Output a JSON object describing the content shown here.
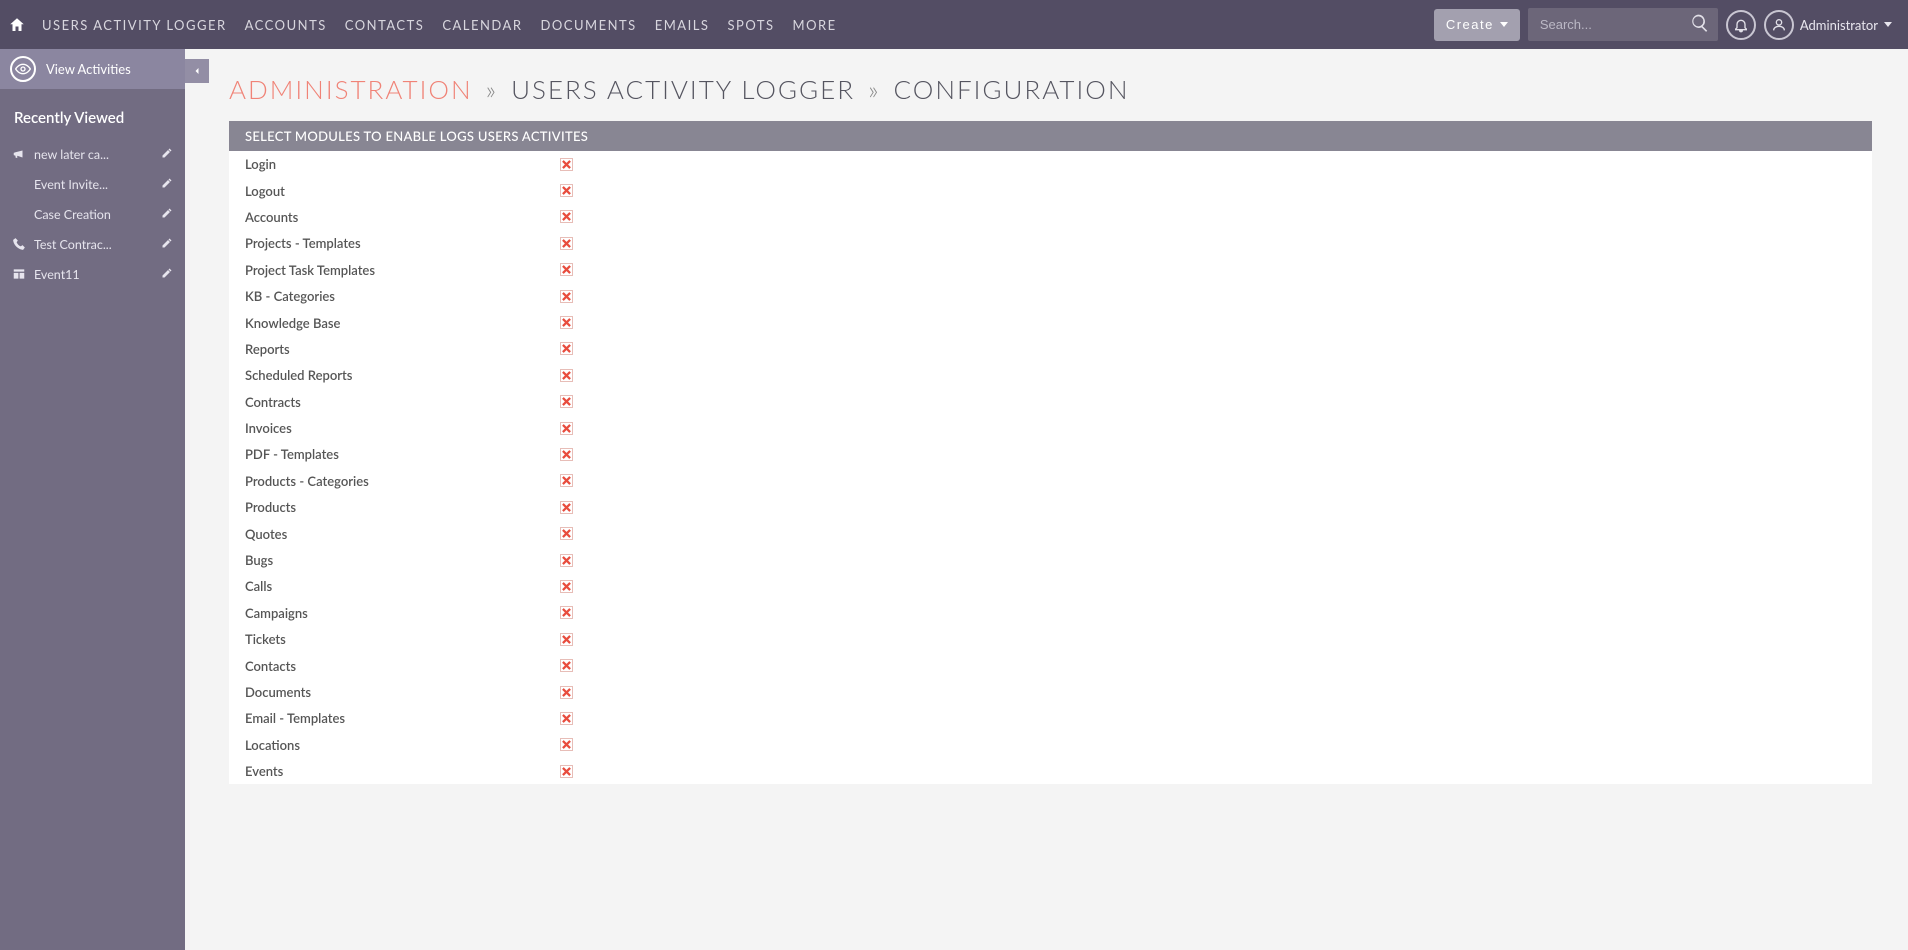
{
  "topnav": {
    "items": [
      "Users Activity Logger",
      "Accounts",
      "Contacts",
      "Calendar",
      "Documents",
      "Emails",
      "Spots",
      "More"
    ]
  },
  "topbar": {
    "create_label": "Create",
    "search_placeholder": "Search...",
    "user_label": "Administrator"
  },
  "sidebar": {
    "tab_label": "View Activities",
    "recent_heading": "Recently Viewed",
    "recent": [
      {
        "label": "new later ca...",
        "icon": "megaphone"
      },
      {
        "label": "Event Invite...",
        "icon": "none"
      },
      {
        "label": "Case Creation",
        "icon": "none"
      },
      {
        "label": "Test Contrac...",
        "icon": "phone"
      },
      {
        "label": "Event11",
        "icon": "layout"
      }
    ]
  },
  "breadcrumb": {
    "admin": "Administration",
    "sep": "»",
    "mid": "Users Activity Logger",
    "leaf": "Configuration"
  },
  "panel": {
    "header": "SELECT MODULES TO ENABLE LOGS USERS ACTIVITES"
  },
  "modules": [
    "Login",
    "Logout",
    "Accounts",
    "Projects - Templates",
    "Project Task Templates",
    "KB - Categories",
    "Knowledge Base",
    "Reports",
    "Scheduled Reports",
    "Contracts",
    "Invoices",
    "PDF - Templates",
    "Products - Categories",
    "Products",
    "Quotes",
    "Bugs",
    "Calls",
    "Campaigns",
    "Tickets",
    "Contacts",
    "Documents",
    "Email - Templates",
    "Locations",
    "Events"
  ]
}
